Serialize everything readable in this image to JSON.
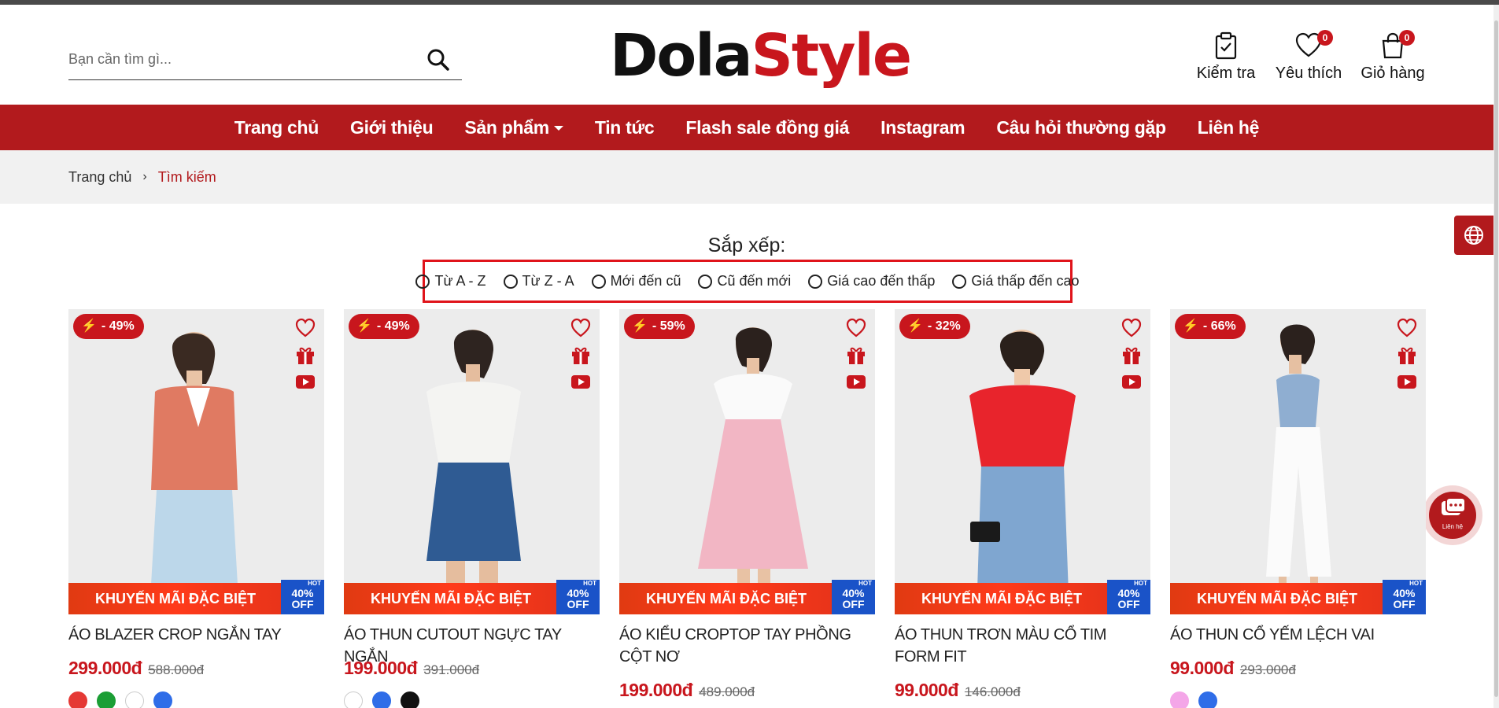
{
  "header": {
    "search": {
      "placeholder": "Bạn cần tìm gì..."
    },
    "logo": {
      "part1": "Dola",
      "part2": "Style"
    },
    "icons": [
      {
        "name": "check-order",
        "label": "Kiểm tra",
        "icon": "clipboard-check-icon"
      },
      {
        "name": "wishlist",
        "label": "Yêu thích",
        "icon": "heart-icon",
        "count": "0"
      },
      {
        "name": "cart",
        "label": "Giỏ hàng",
        "icon": "shopping-bag-icon",
        "count": "0"
      }
    ]
  },
  "nav": {
    "items": [
      {
        "label": "Trang chủ"
      },
      {
        "label": "Giới thiệu"
      },
      {
        "label": "Sản phẩm",
        "dropdown": true
      },
      {
        "label": "Tin tức"
      },
      {
        "label": "Flash sale đồng giá"
      },
      {
        "label": "Instagram"
      },
      {
        "label": "Câu hỏi thường gặp"
      },
      {
        "label": "Liên hệ"
      }
    ]
  },
  "breadcrumb": {
    "home": "Trang chủ",
    "separator": "›",
    "current": "Tìm kiếm"
  },
  "sort": {
    "title": "Sắp xếp:",
    "options": [
      "Từ A - Z",
      "Từ Z - A",
      "Mới đến cũ",
      "Cũ đến mới",
      "Giá cao đến thấp",
      "Giá thấp đến cao"
    ]
  },
  "side": {
    "chat_label": "Liên hệ"
  },
  "promo": {
    "banner": "KHUYẾN MÃI ĐẶC BIỆT",
    "hot": "HOT",
    "off_pct": "40%",
    "off": "OFF"
  },
  "products": [
    {
      "discount": "- 49%",
      "name": "ÁO BLAZER CROP NGẮN TAY",
      "price": "299.000đ",
      "old_price": "588.000đ",
      "swatches": [
        "#e53935",
        "#1b9e35",
        "#ffffff",
        "#2f6de8"
      ]
    },
    {
      "discount": "- 49%",
      "name": "ÁO THUN CUTOUT NGỰC TAY NGẮN",
      "price": "199.000đ",
      "old_price": "391.000đ",
      "swatches": [
        "#ffffff",
        "#2f6de8",
        "#111111"
      ]
    },
    {
      "discount": "- 59%",
      "name": "ÁO KIỂU CROPTOP TAY PHỒNG CỘT NƠ",
      "price": "199.000đ",
      "old_price": "489.000đ",
      "swatches": []
    },
    {
      "discount": "- 32%",
      "name": "ÁO THUN TRƠN MÀU CỔ TIM FORM FIT",
      "price": "99.000đ",
      "old_price": "146.000đ",
      "swatches": []
    },
    {
      "discount": "- 66%",
      "name": "ÁO THUN CỔ YẾM LỆCH VAI",
      "price": "99.000đ",
      "old_price": "293.000đ",
      "swatches": [
        "#f4a6e8",
        "#2f6de8"
      ]
    }
  ],
  "colors": {
    "brand_red": "#b21a1d",
    "price_red": "#c8161d",
    "promo_blue": "#1a53c8"
  }
}
